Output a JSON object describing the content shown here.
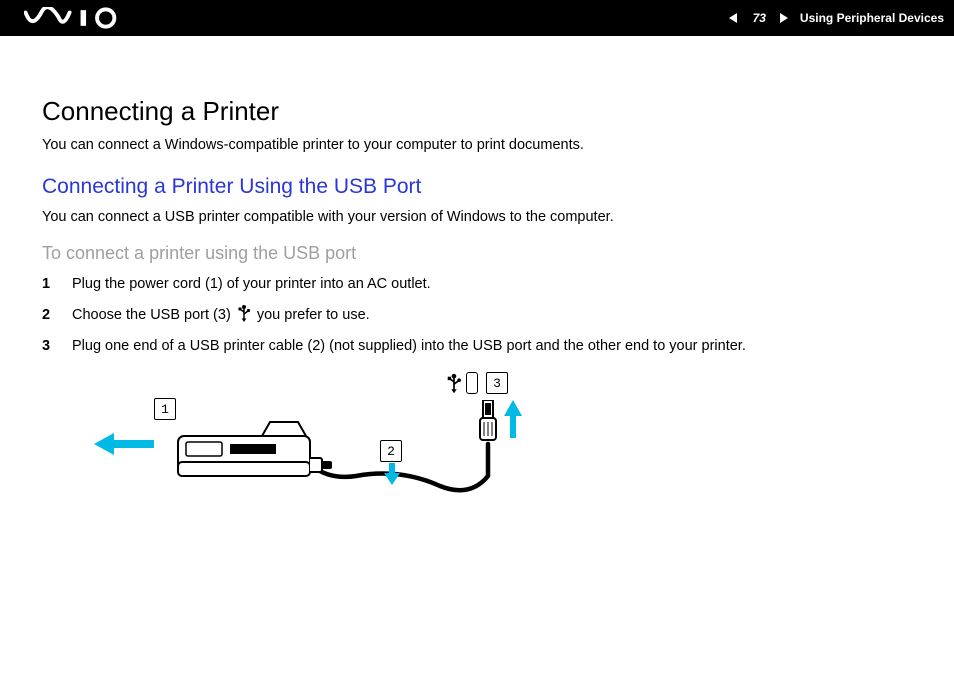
{
  "header": {
    "page_number": "73",
    "section": "Using Peripheral Devices"
  },
  "page": {
    "title": "Connecting a Printer",
    "intro": "You can connect a Windows-compatible printer to your computer to print documents.",
    "subheading": "Connecting a Printer Using the USB Port",
    "sub_intro": "You can connect a USB printer compatible with your version of Windows to the computer.",
    "task_heading": "To connect a printer using the USB port",
    "steps": [
      {
        "n": "1",
        "text": "Plug the power cord (1) of your printer into an AC outlet."
      },
      {
        "n": "2",
        "text_a": "Choose the USB port (3) ",
        "text_b": " you prefer to use."
      },
      {
        "n": "3",
        "text": "Plug one end of a USB printer cable (2) (not supplied) into the USB port and the other end to your printer."
      }
    ]
  },
  "diagram": {
    "callouts": {
      "c1": "1",
      "c2": "2",
      "c3": "3"
    }
  }
}
